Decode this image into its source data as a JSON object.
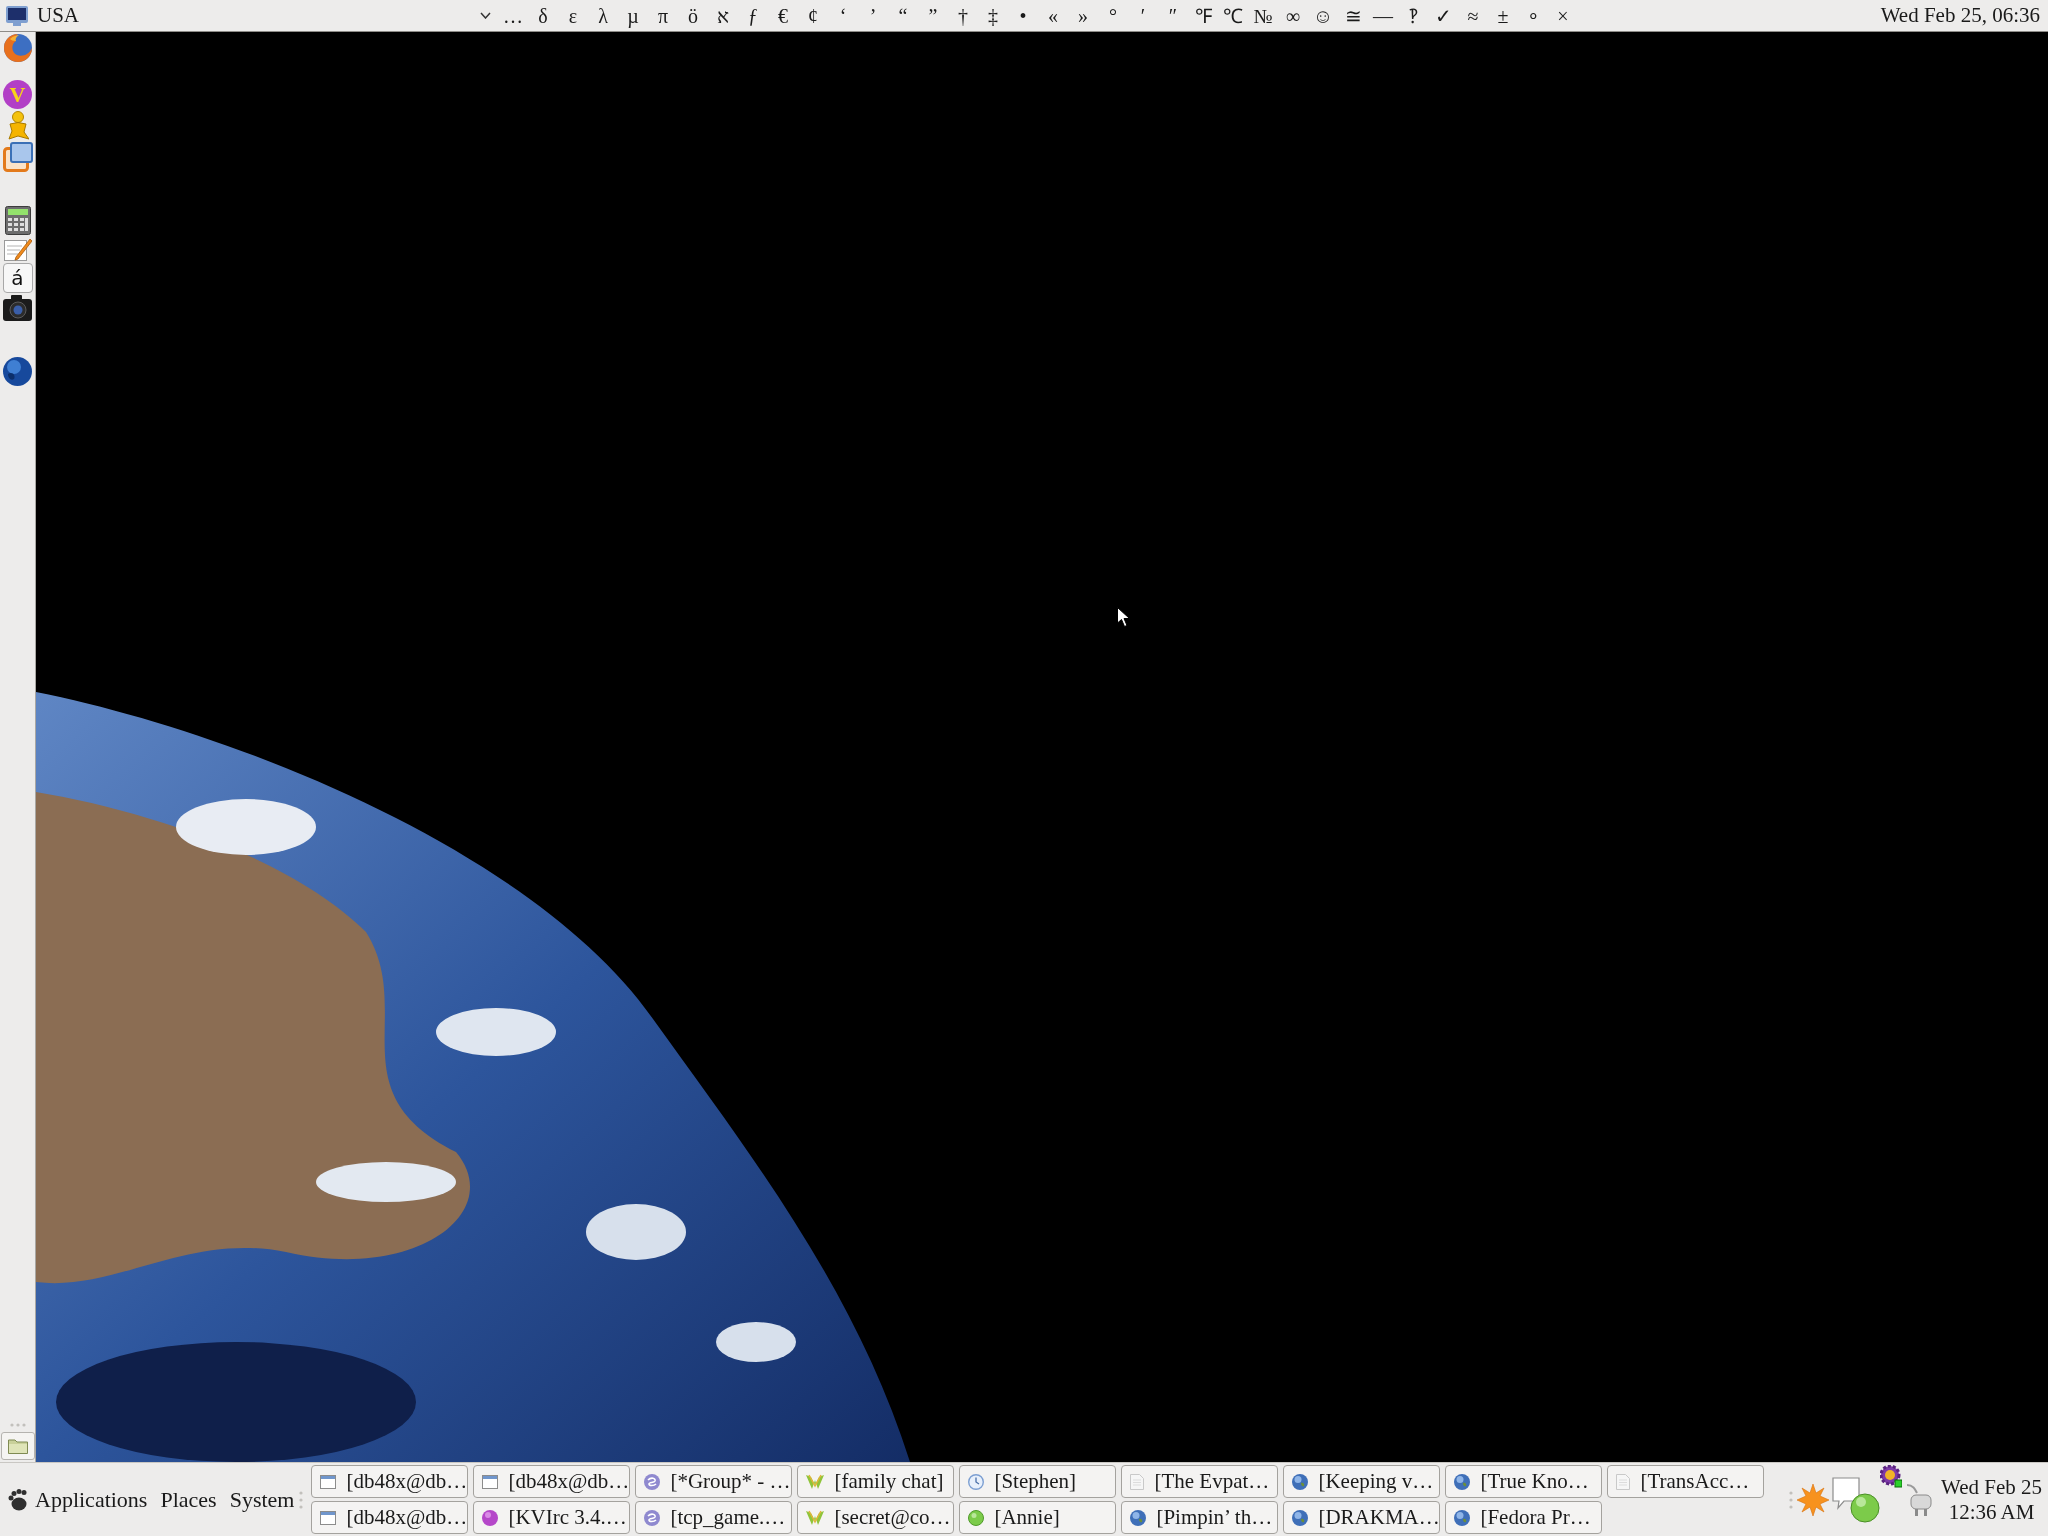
{
  "top_panel": {
    "indicator_label": "USA",
    "characters": [
      "…",
      "δ",
      "ε",
      "λ",
      "µ",
      "π",
      "ö",
      "א",
      "ƒ",
      "€",
      "¢",
      "‘",
      "’",
      "“",
      "”",
      "†",
      "‡",
      "•",
      "«",
      "»",
      "°",
      "′",
      "″",
      "℉",
      "℃",
      "№",
      "∞",
      "☺",
      "≅",
      "—",
      "‽",
      "✓",
      "≈",
      "±",
      "∘",
      "×"
    ],
    "clock": "Wed Feb 25, 06:36"
  },
  "launcher_groups": [
    {
      "items": [
        {
          "kind": "firefox"
        }
      ]
    },
    {
      "items": [
        {
          "kind": "letter_ball",
          "label": "V"
        },
        {
          "kind": "person"
        },
        {
          "kind": "squares"
        }
      ]
    },
    {
      "items": [
        {
          "kind": "calculator"
        },
        {
          "kind": "notepad"
        },
        {
          "kind": "letter_key",
          "label": "á"
        },
        {
          "kind": "camera"
        }
      ]
    },
    {
      "items": [
        {
          "kind": "globe"
        }
      ]
    }
  ],
  "bottom_panel": {
    "menus": [
      "Applications",
      "Places",
      "System"
    ],
    "task_rows": [
      [
        {
          "kind": "window",
          "label": "[db48x@db…"
        },
        {
          "kind": "window",
          "label": "[db48x@db…"
        },
        {
          "kind": "swirl",
          "label": "[*Group* - …"
        },
        {
          "kind": "sprout",
          "label": "[family chat]"
        },
        {
          "kind": "clock",
          "label": "[Stephen]"
        },
        {
          "kind": "page",
          "label": "[The Evpat…"
        },
        {
          "kind": "globe",
          "label": "[Keeping v…"
        },
        {
          "kind": "globe",
          "label": "[True Kno…"
        },
        {
          "kind": "page",
          "label": "[TransAcc…"
        }
      ],
      [
        {
          "kind": "window",
          "label": "[db48x@db…"
        },
        {
          "kind": "ball",
          "label": "[KVIrc 3.4.…"
        },
        {
          "kind": "swirl",
          "label": "[tcp_game.…"
        },
        {
          "kind": "sprout",
          "label": "[secret@co…"
        },
        {
          "kind": "dot",
          "label": "[Annie]"
        },
        {
          "kind": "globe",
          "label": "[Pimpin’ th…"
        },
        {
          "kind": "globe",
          "label": "[DRAKMA…"
        },
        {
          "kind": "globe",
          "label": "[Fedora Pr…"
        }
      ]
    ],
    "clock": {
      "date": "Wed Feb 25",
      "time": "12:36 AM"
    }
  }
}
